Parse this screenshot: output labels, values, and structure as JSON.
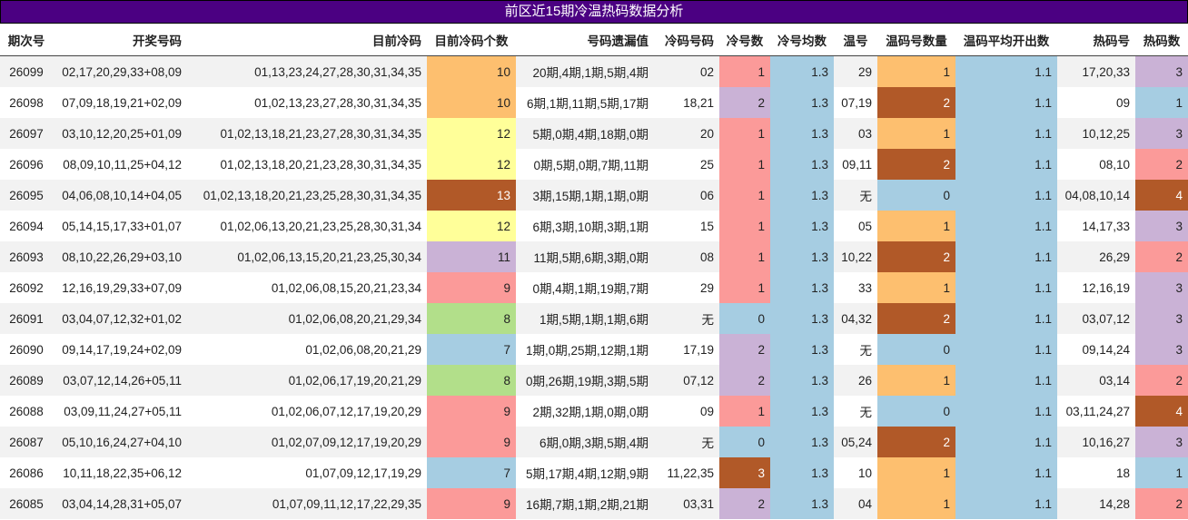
{
  "title": "前区近15期冷温热码数据分析",
  "columns": [
    "期次号",
    "开奖号码",
    "目前冷码",
    "目前冷码个数",
    "号码遗漏值",
    "冷码号码",
    "冷号数",
    "冷号均数",
    "温号",
    "温码号数量",
    "温码平均开出数",
    "热码号",
    "热码数"
  ],
  "colors": {
    "title_bg": "#4b0082",
    "c7": "#a6cde2",
    "c8": "#b2df8a",
    "c9": "#fb9a99",
    "c10": "#fdbf6f",
    "c11": "#cab2d6",
    "c12": "#ffff99",
    "c13": "#b15928",
    "cold0": "#a6cde2",
    "cold1": "#fb9a99",
    "cold2": "#cab2d6",
    "cold3": "#b15928",
    "warm0": "#a6cde2",
    "warm1": "#fdbf6f",
    "warm2": "#b15928",
    "hot1": "#a6cde2",
    "hot2": "#fb9a99",
    "hot3": "#cab2d6",
    "hot4": "#b15928"
  },
  "rows": [
    {
      "issue": "26099",
      "draw": "02,17,20,29,33+08,09",
      "cold": "01,13,23,24,27,28,30,31,34,35",
      "cold_count": "10",
      "omit": "20期,4期,1期,5期,4期",
      "cold_nums": "02",
      "cold_n": "1",
      "cold_avg": "1.3",
      "warm": "29",
      "warm_n": "1",
      "warm_avg": "1.1",
      "hot": "17,20,33",
      "hot_n": "3"
    },
    {
      "issue": "26098",
      "draw": "07,09,18,19,21+02,09",
      "cold": "01,02,13,23,27,28,30,31,34,35",
      "cold_count": "10",
      "omit": "6期,1期,11期,5期,17期",
      "cold_nums": "18,21",
      "cold_n": "2",
      "cold_avg": "1.3",
      "warm": "07,19",
      "warm_n": "2",
      "warm_avg": "1.1",
      "hot": "09",
      "hot_n": "1"
    },
    {
      "issue": "26097",
      "draw": "03,10,12,20,25+01,09",
      "cold": "01,02,13,18,21,23,27,28,30,31,34,35",
      "cold_count": "12",
      "omit": "5期,0期,4期,18期,0期",
      "cold_nums": "20",
      "cold_n": "1",
      "cold_avg": "1.3",
      "warm": "03",
      "warm_n": "1",
      "warm_avg": "1.1",
      "hot": "10,12,25",
      "hot_n": "3"
    },
    {
      "issue": "26096",
      "draw": "08,09,10,11,25+04,12",
      "cold": "01,02,13,18,20,21,23,28,30,31,34,35",
      "cold_count": "12",
      "omit": "0期,5期,0期,7期,11期",
      "cold_nums": "25",
      "cold_n": "1",
      "cold_avg": "1.3",
      "warm": "09,11",
      "warm_n": "2",
      "warm_avg": "1.1",
      "hot": "08,10",
      "hot_n": "2"
    },
    {
      "issue": "26095",
      "draw": "04,06,08,10,14+04,05",
      "cold": "01,02,13,18,20,21,23,25,28,30,31,34,35",
      "cold_count": "13",
      "omit": "3期,15期,1期,1期,0期",
      "cold_nums": "06",
      "cold_n": "1",
      "cold_avg": "1.3",
      "warm": "无",
      "warm_n": "0",
      "warm_avg": "1.1",
      "hot": "04,08,10,14",
      "hot_n": "4"
    },
    {
      "issue": "26094",
      "draw": "05,14,15,17,33+01,07",
      "cold": "01,02,06,13,20,21,23,25,28,30,31,34",
      "cold_count": "12",
      "omit": "6期,3期,10期,3期,1期",
      "cold_nums": "15",
      "cold_n": "1",
      "cold_avg": "1.3",
      "warm": "05",
      "warm_n": "1",
      "warm_avg": "1.1",
      "hot": "14,17,33",
      "hot_n": "3"
    },
    {
      "issue": "26093",
      "draw": "08,10,22,26,29+03,10",
      "cold": "01,02,06,13,15,20,21,23,25,30,34",
      "cold_count": "11",
      "omit": "11期,5期,6期,3期,0期",
      "cold_nums": "08",
      "cold_n": "1",
      "cold_avg": "1.3",
      "warm": "10,22",
      "warm_n": "2",
      "warm_avg": "1.1",
      "hot": "26,29",
      "hot_n": "2"
    },
    {
      "issue": "26092",
      "draw": "12,16,19,29,33+07,09",
      "cold": "01,02,06,08,15,20,21,23,34",
      "cold_count": "9",
      "omit": "0期,4期,1期,19期,7期",
      "cold_nums": "29",
      "cold_n": "1",
      "cold_avg": "1.3",
      "warm": "33",
      "warm_n": "1",
      "warm_avg": "1.1",
      "hot": "12,16,19",
      "hot_n": "3"
    },
    {
      "issue": "26091",
      "draw": "03,04,07,12,32+01,02",
      "cold": "01,02,06,08,20,21,29,34",
      "cold_count": "8",
      "omit": "1期,5期,1期,1期,6期",
      "cold_nums": "无",
      "cold_n": "0",
      "cold_avg": "1.3",
      "warm": "04,32",
      "warm_n": "2",
      "warm_avg": "1.1",
      "hot": "03,07,12",
      "hot_n": "3"
    },
    {
      "issue": "26090",
      "draw": "09,14,17,19,24+02,09",
      "cold": "01,02,06,08,20,21,29",
      "cold_count": "7",
      "omit": "1期,0期,25期,12期,1期",
      "cold_nums": "17,19",
      "cold_n": "2",
      "cold_avg": "1.3",
      "warm": "无",
      "warm_n": "0",
      "warm_avg": "1.1",
      "hot": "09,14,24",
      "hot_n": "3"
    },
    {
      "issue": "26089",
      "draw": "03,07,12,14,26+05,11",
      "cold": "01,02,06,17,19,20,21,29",
      "cold_count": "8",
      "omit": "0期,26期,19期,3期,5期",
      "cold_nums": "07,12",
      "cold_n": "2",
      "cold_avg": "1.3",
      "warm": "26",
      "warm_n": "1",
      "warm_avg": "1.1",
      "hot": "03,14",
      "hot_n": "2"
    },
    {
      "issue": "26088",
      "draw": "03,09,11,24,27+05,11",
      "cold": "01,02,06,07,12,17,19,20,29",
      "cold_count": "9",
      "omit": "2期,32期,1期,0期,0期",
      "cold_nums": "09",
      "cold_n": "1",
      "cold_avg": "1.3",
      "warm": "无",
      "warm_n": "0",
      "warm_avg": "1.1",
      "hot": "03,11,24,27",
      "hot_n": "4"
    },
    {
      "issue": "26087",
      "draw": "05,10,16,24,27+04,10",
      "cold": "01,02,07,09,12,17,19,20,29",
      "cold_count": "9",
      "omit": "6期,0期,3期,5期,4期",
      "cold_nums": "无",
      "cold_n": "0",
      "cold_avg": "1.3",
      "warm": "05,24",
      "warm_n": "2",
      "warm_avg": "1.1",
      "hot": "10,16,27",
      "hot_n": "3"
    },
    {
      "issue": "26086",
      "draw": "10,11,18,22,35+06,12",
      "cold": "01,07,09,12,17,19,29",
      "cold_count": "7",
      "omit": "5期,17期,4期,12期,9期",
      "cold_nums": "11,22,35",
      "cold_n": "3",
      "cold_avg": "1.3",
      "warm": "10",
      "warm_n": "1",
      "warm_avg": "1.1",
      "hot": "18",
      "hot_n": "1"
    },
    {
      "issue": "26085",
      "draw": "03,04,14,28,31+05,07",
      "cold": "01,07,09,11,12,17,22,29,35",
      "cold_count": "9",
      "omit": "16期,7期,1期,2期,21期",
      "cold_nums": "03,31",
      "cold_n": "2",
      "cold_avg": "1.3",
      "warm": "04",
      "warm_n": "1",
      "warm_avg": "1.1",
      "hot": "14,28",
      "hot_n": "2"
    }
  ]
}
